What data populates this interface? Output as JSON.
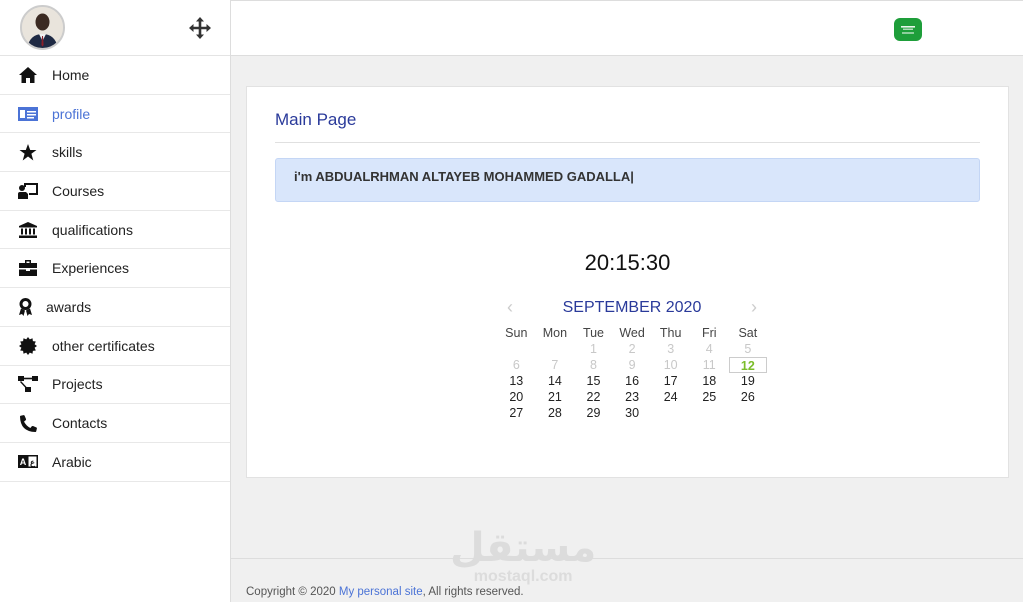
{
  "sidebar": {
    "items": [
      {
        "label": "Home",
        "icon": "home-icon"
      },
      {
        "label": "profile",
        "icon": "id-card-icon"
      },
      {
        "label": "skills",
        "icon": "star-icon"
      },
      {
        "label": "Courses",
        "icon": "chalkboard-teacher-icon"
      },
      {
        "label": "qualifications",
        "icon": "university-icon"
      },
      {
        "label": "Experiences",
        "icon": "briefcase-icon"
      },
      {
        "label": "awards",
        "icon": "award-icon"
      },
      {
        "label": "other certificates",
        "icon": "certificate-icon"
      },
      {
        "label": "Projects",
        "icon": "project-diagram-icon"
      },
      {
        "label": "Contacts",
        "icon": "phone-icon"
      },
      {
        "label": "Arabic",
        "icon": "language-icon"
      }
    ],
    "active_index": 1,
    "active_color": "#4b73d6"
  },
  "main": {
    "title": "Main Page",
    "intro": "i'm ABDUALRHMAN ALTAYEB MOHAMMED GADALLA|",
    "clock": "20:15:30"
  },
  "calendar": {
    "month_label": "SEPTEMBER 2020",
    "weekdays": [
      "Sun",
      "Mon",
      "Tue",
      "Wed",
      "Thu",
      "Fri",
      "Sat"
    ],
    "selected_day": "12"
  },
  "footer": {
    "prefix": "Copyright © 2020 ",
    "link": "My personal site",
    "suffix": ", All rights reserved."
  },
  "watermark": {
    "arabic": "مستقل",
    "latin": "mostaql.com"
  }
}
